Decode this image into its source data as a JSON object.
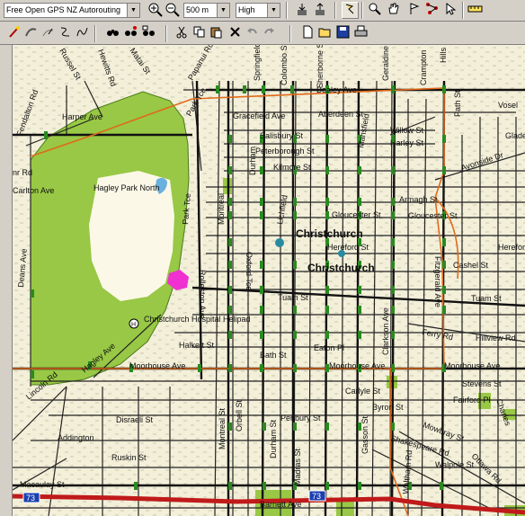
{
  "toolbar": {
    "map_select": "Free Open GPS NZ Autorouting",
    "zoom_select": "500 m",
    "detail_select": "High"
  },
  "icons": {
    "zoom_in": "zoom-in-icon",
    "zoom_out": "zoom-out-icon",
    "find": "binoculars-icon"
  },
  "map": {
    "city_labels": [
      "Christchurch",
      "Christchurch"
    ],
    "park_label": "Hagley Park North",
    "hospital_label": "Christchurch Hospital Helipad",
    "highway_label": "73",
    "streets": {
      "harper_ave": "Harper Ave",
      "fendalton_rd": "Fendalton Rd",
      "russel_st": "Russel St",
      "hewitts_rd": "Hewitts Rd",
      "matai_st": "Matai St",
      "papanui_rd": "Papanui Rd",
      "park_tce": "Park Tce",
      "springfield": "Springfield",
      "colombo_st_n": "Colombo St",
      "sherborne_st": "Sherborne St",
      "bealey_ave": "Bealey Ave",
      "geraldine": "Geraldine",
      "crampton": "Crampton",
      "hills": "Hills",
      "vosel": "Vosel",
      "barbadoes_st": "Barbadoes St",
      "gracefield_ave": "Gracefield Ave",
      "aberdeen_st": "Aberdeen St",
      "salisbury_st": "Salisbury St",
      "willow_st": "Willow St",
      "harley_st": "Harley St",
      "glade": "Glade",
      "peterborough_st": "Peterborough St",
      "kilmore_st": "Kilmore St",
      "avonside_dr": "Avonside Dr",
      "armagh_st": "Armagh St",
      "gloucester_st_w": "Gloucester St",
      "gloucester_st_e": "Gloucester St",
      "hereford_st": "Hereford St",
      "hereford_e": "Hereford",
      "cashel_st": "Cashel St",
      "tuam_st": "Tuam St",
      "tuam_st_e": "Tuam St",
      "ferry_rd": "Ferry Rd",
      "hillview_rd": "Hillview Rd",
      "halkett_st": "Halkett St",
      "bath_st": "Bath St",
      "eaton_pl": "Eaton Pl",
      "moorhouse_ave_w": "Moorhouse Ave",
      "moorhouse_ave_c": "Moorhouse Ave",
      "moorhouse_ave_e": "Moorhouse Ave",
      "stevens_st": "Stevens St",
      "fairford_pl": "Fairford Pl",
      "carlyle_st": "Carlyle St",
      "byron_st": "Byron St",
      "disraeli_st": "Disraeli St",
      "lincoln_rd": "Lincoln Rd",
      "antigua_st": "Antigua St",
      "addington": "Addington",
      "macaulay_st": "Macaulay St",
      "ruskin_st": "Ruskin St",
      "fenbury_st": "Penbury St",
      "mowbray_st": "Mowbray St",
      "shakespeare_rd": "Shakespeare Rd",
      "walpole_st": "Walpole St",
      "charles": "Charles",
      "ottawa_rd": "Ottawa Rd",
      "barnett_ave": "Barnett Ave",
      "montreal_st": "Montreal St",
      "durham_st": "Durham St",
      "orbell_st": "Orbell St",
      "madras_st": "Madras St",
      "gasson_st": "Gasson St",
      "waltham_rd": "Waltham Rd",
      "fitzgerald_ave": "Fitzgerald Ave",
      "clarkson_ave": "Clarkson Ave",
      "rolleston_ave": "Rolleston Ave",
      "oxford_tce": "Oxford Tce",
      "park_tce_s": "Park Tce",
      "deans_ave": "Deans Ave",
      "hagley_ave": "Hagley Ave",
      "riccarton_ave": "Riccarton Ave",
      "carlton": "Carlton Ave",
      "clyde_rd": "nr Rd",
      "hospital_ave": "Christchurch Hospital Helipad",
      "colombo_st_s": "Colombo St",
      "lichfield": "Lichfield",
      "montreal_n": "Montreal",
      "durham_n": "Durham",
      "mansfield": "Mansfield",
      "path_st": "Path St"
    }
  }
}
